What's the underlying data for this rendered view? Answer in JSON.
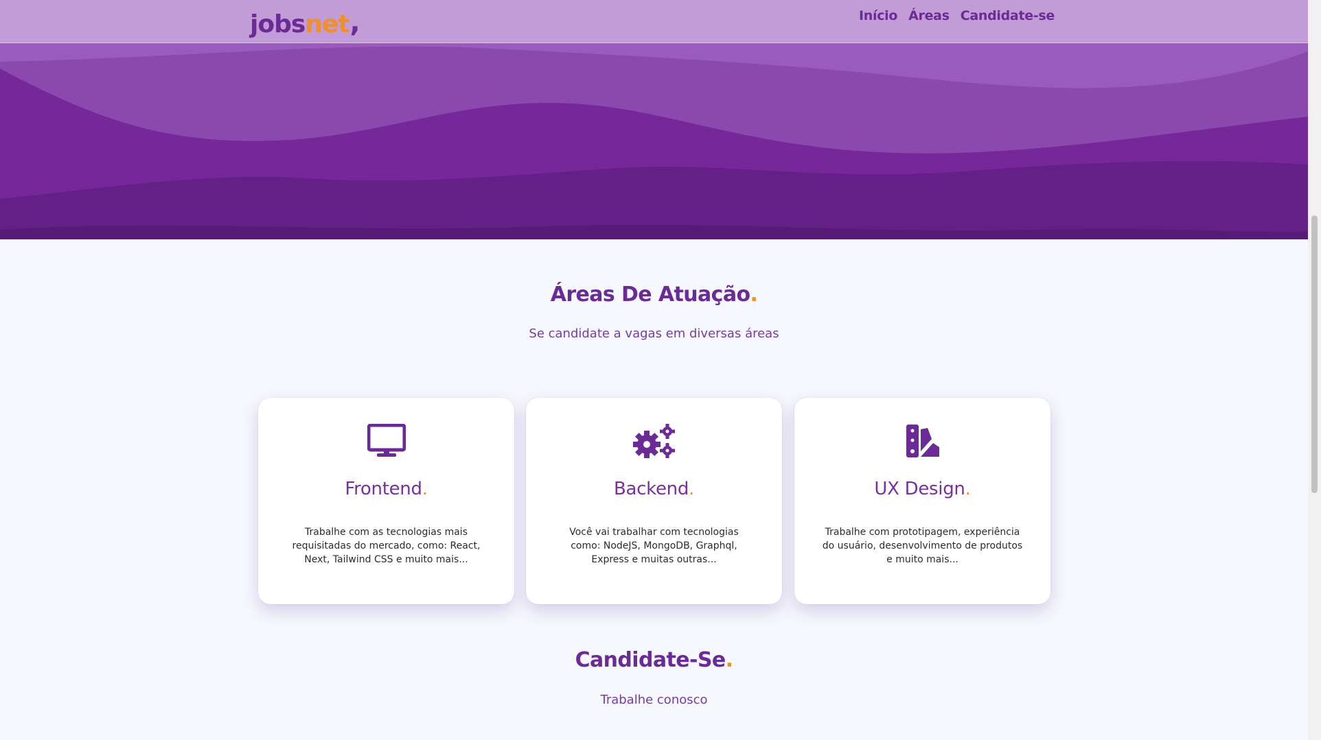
{
  "brand": {
    "logo_part1": "jobs",
    "logo_part2": "net",
    "logo_comma": ","
  },
  "nav": {
    "items": [
      {
        "label": "Início"
      },
      {
        "label": "Áreas"
      },
      {
        "label": "Candidate-se"
      }
    ]
  },
  "areas": {
    "title": "Áreas De Atuação",
    "title_dot": ".",
    "subtitle": "Se candidate a vagas em diversas áreas",
    "cards": [
      {
        "icon": "monitor-icon",
        "title": "Frontend",
        "dot": ".",
        "description": "Trabalhe com as tecnologias mais requisitadas do mercado, como: React, Next, Tailwind CSS e muito mais..."
      },
      {
        "icon": "gears-icon",
        "title": "Backend",
        "dot": ".",
        "description": "Você vai trabalhar com tecnologias como: NodeJS, MongoDB, Graphql, Express e muitas outras..."
      },
      {
        "icon": "swatchbook-icon",
        "title": "UX Design",
        "dot": ".",
        "description": "Trabalhe com prototipagem, experiência do usuário, desenvolvimento de produtos e muito mais..."
      }
    ]
  },
  "apply": {
    "title": "Candidate-Se",
    "title_dot": ".",
    "subtitle": "Trabalhe conosco"
  },
  "colors": {
    "primary": "#6b2a95",
    "accent": "#f0902a",
    "background": "#f5f8fc"
  }
}
